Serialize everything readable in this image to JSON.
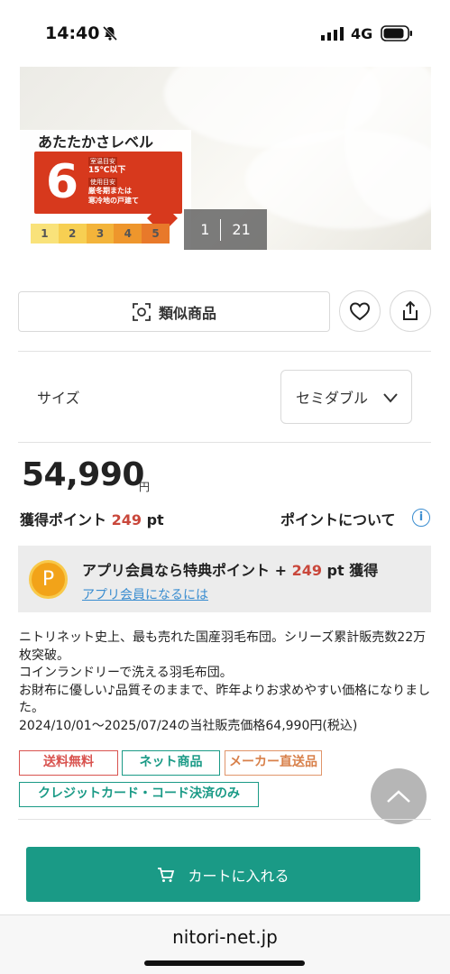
{
  "status_bar": {
    "time": "14:40",
    "network": "4G"
  },
  "hero": {
    "level_title": "あたたかさレベル",
    "level_number": "6",
    "tag_top": "室温目安",
    "temp": "15℃以下",
    "tag_bottom": "使用目安",
    "usage_line1": "厳冬期または",
    "usage_line2": "寒冷地の戸建て",
    "scale": [
      "1",
      "2",
      "3",
      "4",
      "5"
    ],
    "scale_colors": [
      "#f9e27a",
      "#f7cf52",
      "#f3b43a",
      "#ee962c",
      "#e8792a"
    ],
    "counter_current": "1",
    "counter_total": "21"
  },
  "actions": {
    "similar_label": "類似商品"
  },
  "size": {
    "label": "サイズ",
    "value": "セミダブル"
  },
  "price": {
    "amount": "54,990",
    "unit": "円"
  },
  "points": {
    "label": "獲得ポイント",
    "value": "249",
    "unit": "pt",
    "info_link": "ポイントについて"
  },
  "app_points": {
    "prefix": "アプリ会員なら特典ポイント + ",
    "value": "249",
    "suffix": " pt 獲得",
    "link": "アプリ会員になるには"
  },
  "description": {
    "line1": "ニトリネット史上、最も売れた国産羽毛布団。シリーズ累計販売数22万枚突破。",
    "line2": "コインランドリーで洗える羽毛布団。",
    "line3": "お財布に優しい♪品質そのままで、昨年よりお求めやすい価格になりました。",
    "line4": "2024/10/01〜2025/07/24の当社販売価格64,990円(税込)"
  },
  "tags": {
    "free_shipping": "送料無料",
    "online_only": "ネット商品",
    "maker_direct": "メーカー直送品",
    "card_only": "クレジットカード・コード決済のみ"
  },
  "cart": {
    "label": "カートに入れる"
  },
  "browser": {
    "domain": "nitori-net.jp"
  },
  "colors": {
    "accent": "#1a9a86",
    "points": "#c9473b",
    "link": "#3a8dd0",
    "level_red": "#d7391d"
  }
}
